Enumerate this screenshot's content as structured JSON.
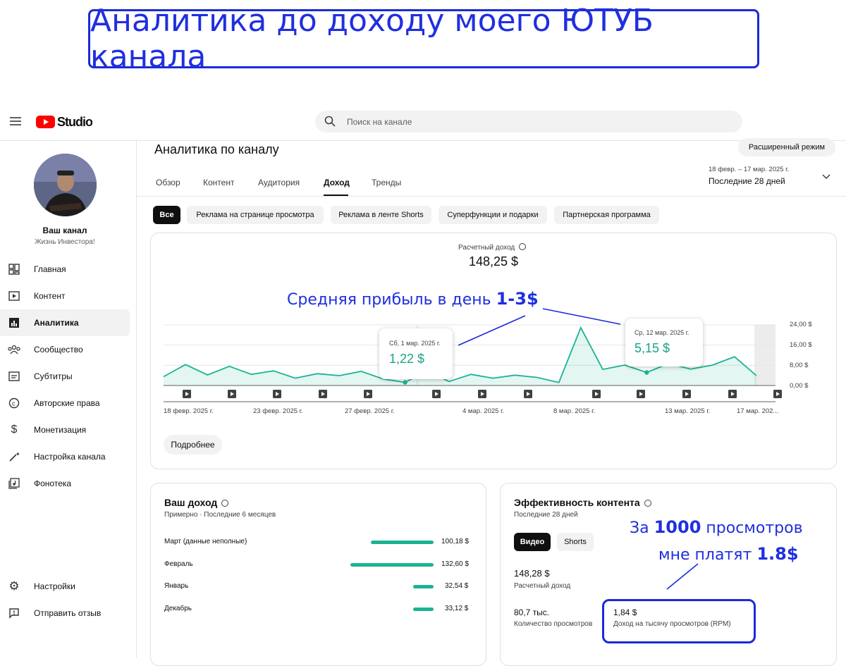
{
  "banner": {
    "title": "Аналитика до доходу моего ЮТУБ канала"
  },
  "header": {
    "logo_text": "Studio",
    "search_placeholder": "Поиск на канале"
  },
  "channel": {
    "name": "Ваш канал",
    "subtitle": "Жизнь Инвестора!"
  },
  "sidebar": {
    "items": [
      {
        "label": "Главная",
        "icon": "dashboard-icon"
      },
      {
        "label": "Контент",
        "icon": "content-icon"
      },
      {
        "label": "Аналитика",
        "icon": "analytics-icon",
        "active": true
      },
      {
        "label": "Сообщество",
        "icon": "community-icon"
      },
      {
        "label": "Субтитры",
        "icon": "subtitles-icon"
      },
      {
        "label": "Авторские права",
        "icon": "copyright-icon"
      },
      {
        "label": "Монетизация",
        "icon": "dollar-icon"
      },
      {
        "label": "Настройка канала",
        "icon": "magic-wand-icon"
      },
      {
        "label": "Фонотека",
        "icon": "audio-library-icon"
      }
    ],
    "bottom": [
      {
        "label": "Настройки",
        "icon": "gear-icon"
      },
      {
        "label": "Отправить отзыв",
        "icon": "feedback-icon"
      }
    ]
  },
  "page": {
    "title": "Аналитика по каналу",
    "advanced_mode": "Расширенный режим",
    "tabs": [
      "Обзор",
      "Контент",
      "Аудитория",
      "Доход",
      "Тренды"
    ],
    "active_tab": "Доход",
    "date_range": "18 февр. – 17 мар. 2025 г.",
    "date_label": "Последние 28 дней",
    "chips": [
      "Все",
      "Реклама на странице просмотра",
      "Реклама в ленте Shorts",
      "Суперфункции и подарки",
      "Партнерская программа"
    ]
  },
  "revenue_card": {
    "label": "Расчетный доход",
    "value": "148,25 $",
    "more_button": "Подробнее",
    "annotation_text": "Средняя прибыль в день",
    "annotation_value": "1-3$",
    "tooltip1": {
      "date": "Сб, 1 мар. 2025 г.",
      "value": "1,22 $"
    },
    "tooltip2": {
      "date": "Ср, 12 мар. 2025 г.",
      "value": "5,15 $"
    }
  },
  "chart_data": {
    "type": "area",
    "title": "Расчетный доход",
    "x": [
      "18 февр.",
      "19 февр.",
      "20 февр.",
      "21 февр.",
      "22 февр.",
      "23 февр.",
      "24 февр.",
      "25 февр.",
      "26 февр.",
      "27 февр.",
      "28 февр.",
      "1 мар.",
      "2 мар.",
      "3 мар.",
      "4 мар.",
      "5 мар.",
      "6 мар.",
      "7 мар.",
      "8 мар.",
      "9 мар.",
      "10 мар.",
      "11 мар.",
      "12 мар.",
      "13 мар.",
      "14 мар.",
      "15 мар.",
      "16 мар.",
      "17 мар."
    ],
    "values": [
      3.5,
      8.3,
      4.2,
      7.6,
      4.4,
      5.8,
      2.9,
      4.7,
      3.9,
      5.6,
      2.6,
      1.22,
      5.9,
      1.6,
      4.4,
      2.9,
      4.1,
      3.2,
      1.2,
      22.9,
      6.4,
      8.1,
      5.15,
      8.7,
      6.5,
      8.1,
      11.4,
      3.9
    ],
    "y_ticks": [
      "24,00 $",
      "16,00 $",
      "8,00 $",
      "0,00 $"
    ],
    "ylim": [
      0,
      24
    ],
    "x_tick_labels": [
      "18 февр. 2025 г.",
      "23 февр. 2025 г.",
      "27 февр. 2025 г.",
      "4 мар. 2025 г.",
      "8 мар. 2025 г.",
      "13 мар. 2025 г.",
      "17 мар. 202..."
    ],
    "color": "#1ab394"
  },
  "income_card": {
    "title": "Ваш доход",
    "subtitle": "Примерно · Последние 6 месяцев",
    "months": [
      {
        "label": "Март (данные неполные)",
        "value": "100,18 $",
        "amount": 100.18
      },
      {
        "label": "Февраль",
        "value": "132,60 $",
        "amount": 132.6
      },
      {
        "label": "Январь",
        "value": "32,54 $",
        "amount": 32.54
      },
      {
        "label": "Декабрь",
        "value": "33,12 $",
        "amount": 33.12
      }
    ]
  },
  "content_card": {
    "title": "Эффективность контента",
    "subtitle": "Последние 28 дней",
    "toggle": [
      "Видео",
      "Shorts"
    ],
    "revenue_value": "148,28 $",
    "revenue_label": "Расчетный доход",
    "views_value": "80,7 тыс.",
    "views_label": "Количество просмотров",
    "rpm_value": "1,84 $",
    "rpm_label": "Доход на тысячу просмотров (RPM)",
    "annotation_line1_a": "За",
    "annotation_line1_b": "1000",
    "annotation_line1_c": "просмотров",
    "annotation_line2_a": "мне платят",
    "annotation_line2_b": "1.8$"
  }
}
